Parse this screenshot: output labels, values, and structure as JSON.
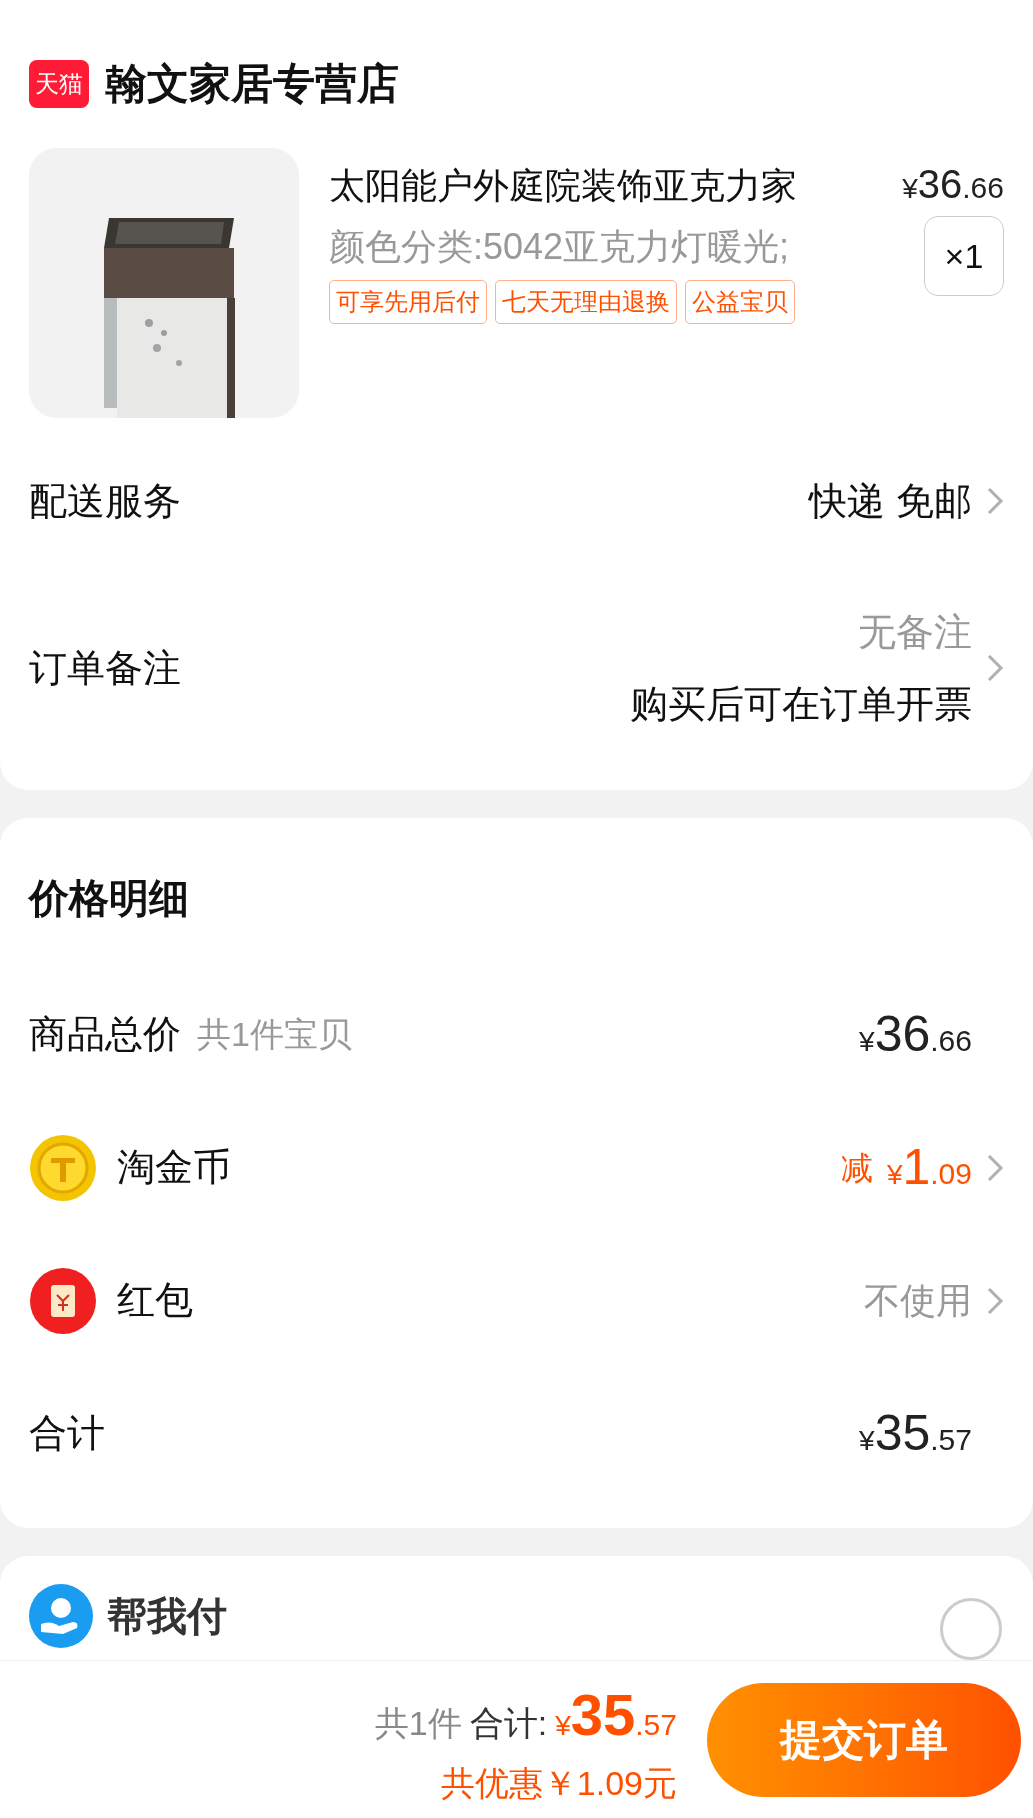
{
  "store": {
    "badge": "天猫",
    "name": "翰文家居专营店"
  },
  "product": {
    "image": {
      "kind": "picture"
    },
    "title": "太阳能户外庭院装饰亚克力家",
    "price_symbol": "¥",
    "price_int": "36",
    "price_dec": ".66",
    "variant": "颜色分类:5042亚克力灯暖光;",
    "tags": [
      "可享先用后付",
      "七天无理由退换",
      "公益宝贝"
    ],
    "quantity": "×1"
  },
  "delivery": {
    "label": "配送服务",
    "value": "快递 免邮"
  },
  "remark": {
    "label": "订单备注",
    "value": "无备注",
    "note": "购买后可在订单开票"
  },
  "price_detail": {
    "title": "价格明细",
    "rows": [
      {
        "kind": "plain",
        "label": "商品总价",
        "sub": "共1件宝贝",
        "symbol": "¥",
        "int": "36",
        "dec": ".66",
        "arrow": false
      },
      {
        "kind": "coin",
        "label": "淘金币",
        "prefix": "减",
        "symbol": "¥",
        "int": "1",
        "dec": ".09",
        "arrow": true
      },
      {
        "kind": "redpacket",
        "label": "红包",
        "value": "不使用",
        "arrow": true
      },
      {
        "kind": "plain",
        "label": "合计",
        "symbol": "¥",
        "int": "35",
        "dec": ".57",
        "arrow": false
      }
    ]
  },
  "help_pay": {
    "title": "帮我付",
    "checked": false
  },
  "bottom_bar": {
    "count": "共1件",
    "total_label": "合计:",
    "symbol": "¥",
    "int": "35",
    "dec": ".57",
    "discount": "共优惠￥1.09元",
    "submit": "提交订单"
  }
}
